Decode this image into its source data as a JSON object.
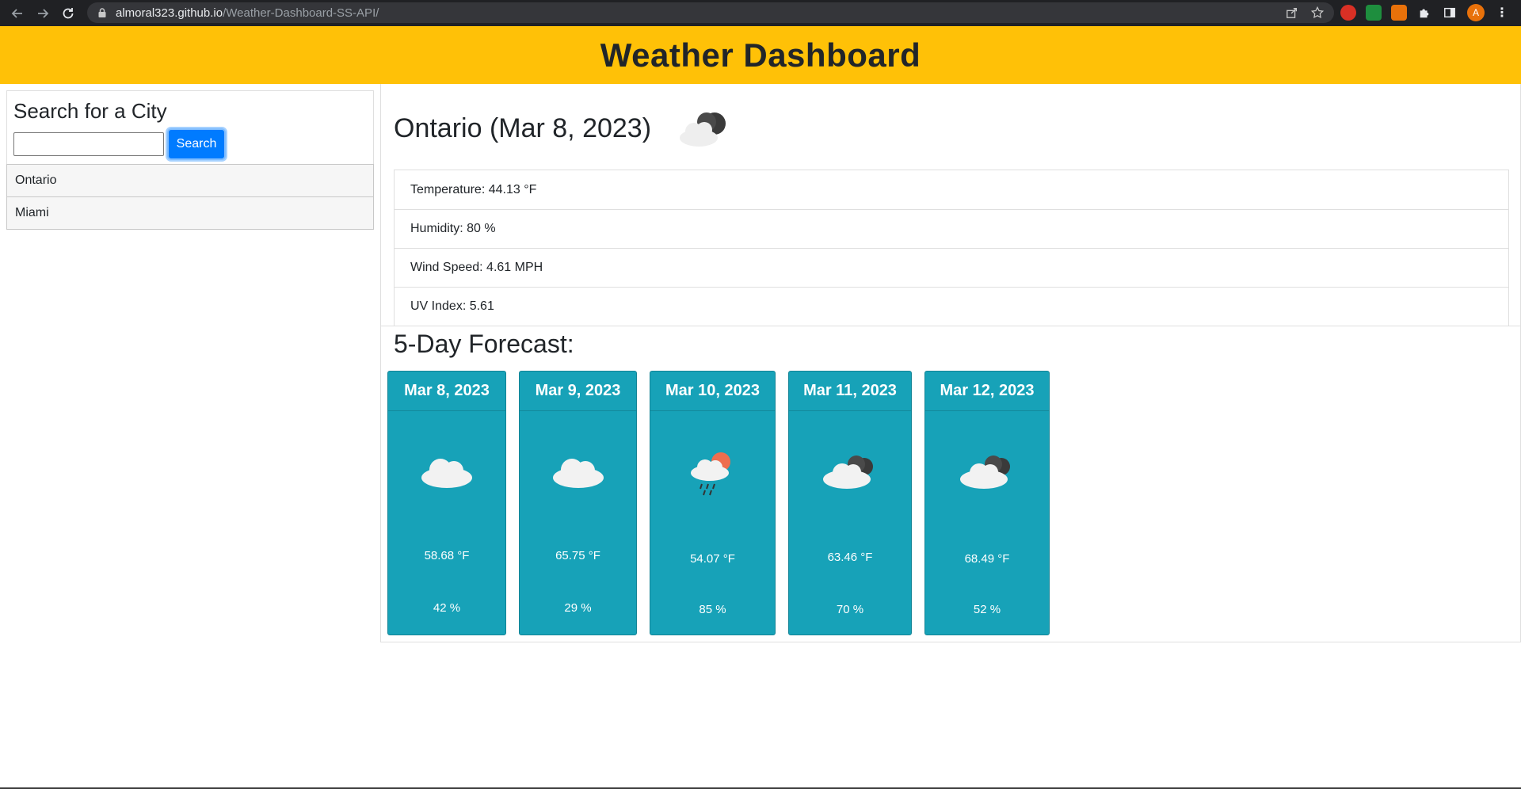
{
  "browser": {
    "url_host": "almoral323.github.io",
    "url_path": "/Weather-Dashboard-SS-API/",
    "avatar_letter": "A"
  },
  "header": {
    "title": "Weather Dashboard"
  },
  "sidebar": {
    "search_title": "Search for a City",
    "search_value": "",
    "search_button": "Search",
    "history": [
      {
        "label": "Ontario"
      },
      {
        "label": "Miami"
      }
    ]
  },
  "current": {
    "title": "Ontario (Mar 8, 2023)",
    "icon": "broken-clouds-icon",
    "stats": {
      "temperature": "Temperature: 44.13 °F",
      "humidity": "Humidity: 80 %",
      "wind": "Wind Speed: 4.61 MPH",
      "uv": "UV Index: 5.61"
    }
  },
  "forecast": {
    "title": "5-Day Forecast:",
    "days": [
      {
        "date": "Mar 8, 2023",
        "icon": "cloud-icon",
        "temp": "58.68 °F",
        "humidity": "42 %"
      },
      {
        "date": "Mar 9, 2023",
        "icon": "cloud-icon",
        "temp": "65.75 °F",
        "humidity": "29 %"
      },
      {
        "date": "Mar 10, 2023",
        "icon": "rain-sun-icon",
        "temp": "54.07 °F",
        "humidity": "85 %"
      },
      {
        "date": "Mar 11, 2023",
        "icon": "broken-clouds-icon",
        "temp": "63.46 °F",
        "humidity": "70 %"
      },
      {
        "date": "Mar 12, 2023",
        "icon": "broken-clouds-icon",
        "temp": "68.49 °F",
        "humidity": "52 %"
      }
    ]
  },
  "colors": {
    "header_bg": "#ffc107",
    "card_bg": "#17a2b8",
    "button_bg": "#007bff"
  }
}
